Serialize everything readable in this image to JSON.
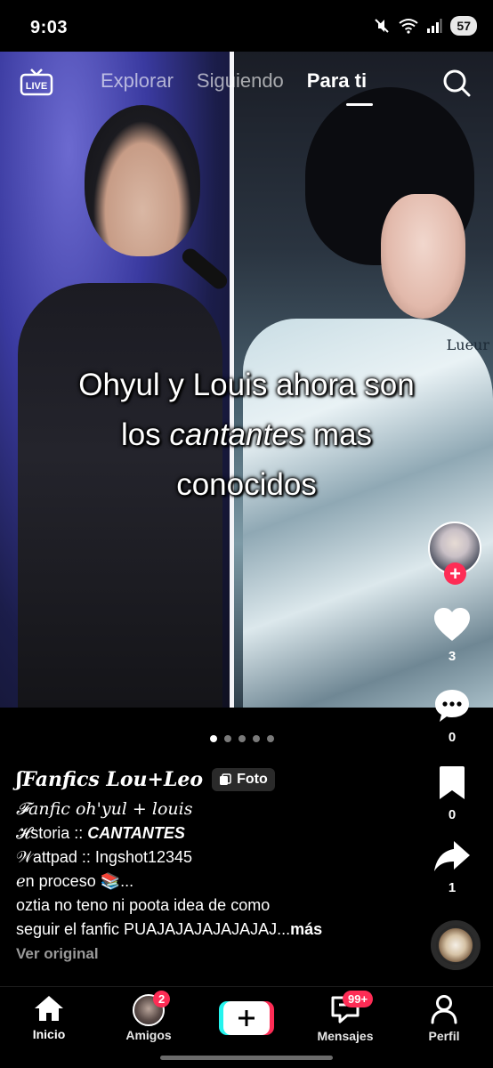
{
  "status_bar": {
    "time": "9:03",
    "battery": "57"
  },
  "top_nav": {
    "live_label": "LIVE",
    "tabs": [
      {
        "label": "Explorar",
        "active": false
      },
      {
        "label": "Siguiendo",
        "active": false
      },
      {
        "label": "Para ti",
        "active": true
      }
    ]
  },
  "post": {
    "overlay_text": {
      "line1": "Ohyul y Louis ahora son",
      "line2_pre": "los ",
      "line2_em": "cantantes",
      "line2_post": " mas",
      "line3": "conocidos"
    },
    "photo_brand_text": "Lueur",
    "carousel": {
      "count": 5,
      "active_index": 0
    },
    "author": "ʃFanfics Lou+Leo",
    "type_badge": "Foto",
    "caption": {
      "title": "𝓕anfic oh'yul + louis",
      "historia_label": "𝓗storia :: ",
      "historia_value": "CANTANTES",
      "wattpad_label": "𝒲attpad :: ",
      "wattpad_value": "Ingshot12345",
      "estado": "ℯn proceso 📚...",
      "body_line1": "oztia no teno ni poota idea de como",
      "body_line2": "seguir el fanfic PUAJAJAJAJAJAJAJ...",
      "more": "más"
    },
    "ver_original": "Ver original"
  },
  "rail": {
    "likes": "3",
    "comments": "0",
    "saves": "0",
    "shares": "1"
  },
  "bottom_nav": {
    "inicio": "Inicio",
    "amigos": "Amigos",
    "amigos_badge": "2",
    "mensajes": "Mensajes",
    "mensajes_badge": "99+",
    "perfil": "Perfil"
  },
  "colors": {
    "accent": "#fe2c55",
    "cyan": "#25f4ee",
    "background": "#000000"
  }
}
